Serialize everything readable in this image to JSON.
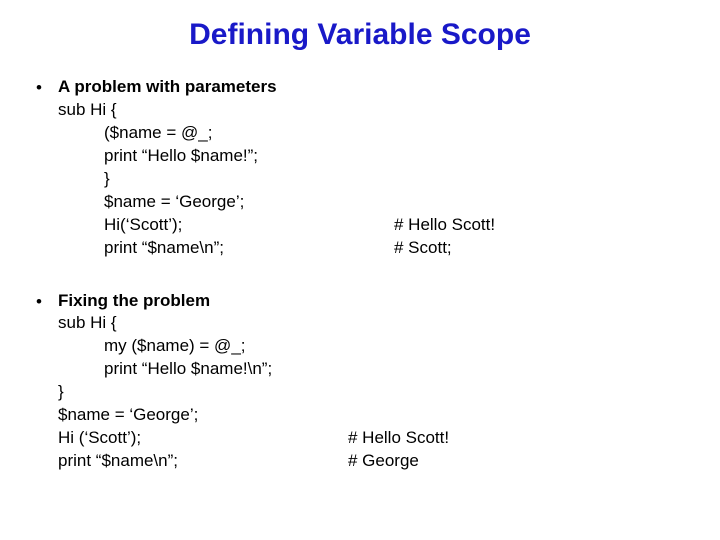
{
  "title": "Defining Variable Scope",
  "section1": {
    "heading": "A problem with parameters",
    "lines": {
      "l0": "sub Hi {",
      "l1": "($name = @_;",
      "l2": "print “Hello $name!”;",
      "l3": "}",
      "l4": "$name = ‘George’;",
      "l5": "Hi(‘Scott’);",
      "l5c": "# Hello Scott!",
      "l6": "print “$name\\n”;",
      "l6c": "# Scott;"
    }
  },
  "section2": {
    "heading": "Fixing the problem",
    "lines": {
      "l0": "sub Hi {",
      "l1": "my ($name) = @_;",
      "l2": "print “Hello $name!\\n”;",
      "l3": "}",
      "l4": "$name = ‘George’;",
      "l5": "Hi (‘Scott’);",
      "l5c": "# Hello Scott!",
      "l6": "print “$name\\n”;",
      "l6c": "# George"
    }
  }
}
